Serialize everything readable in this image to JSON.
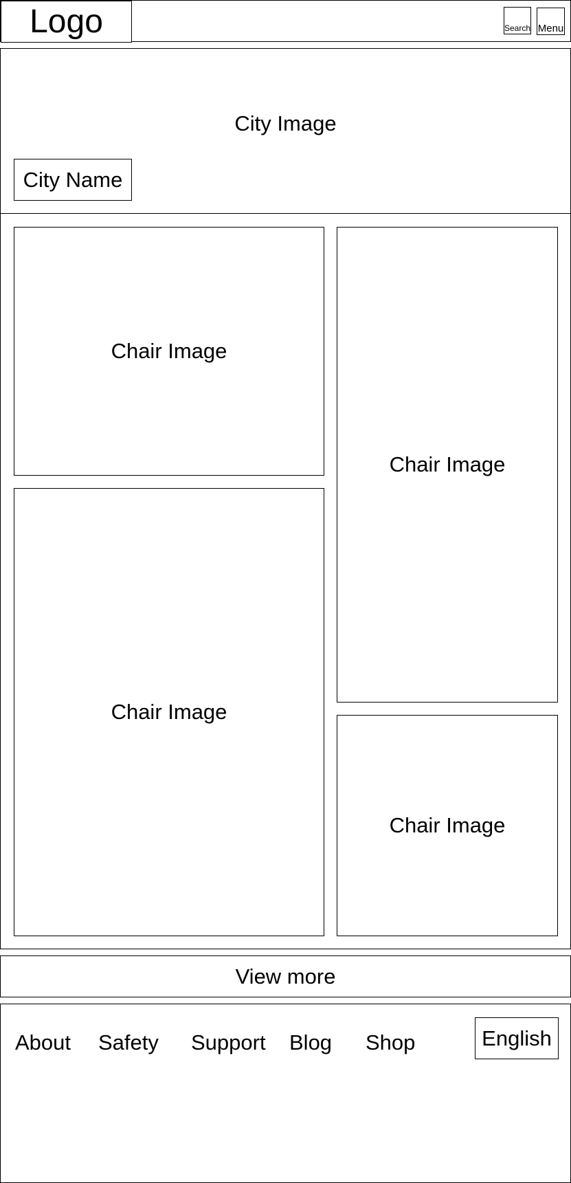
{
  "header": {
    "logo": "Logo",
    "search_label": "Search",
    "menu_label": "Menu"
  },
  "hero": {
    "image_label": "City Image",
    "city_name": "City Name"
  },
  "gallery": {
    "items": [
      {
        "label": "Chair Image"
      },
      {
        "label": "Chair Image"
      },
      {
        "label": "Chair Image"
      },
      {
        "label": "Chair Image"
      }
    ]
  },
  "view_more_label": "View more",
  "footer": {
    "links": [
      {
        "label": "About"
      },
      {
        "label": "Safety"
      },
      {
        "label": "Support"
      },
      {
        "label": "Blog"
      },
      {
        "label": "Shop"
      }
    ],
    "language": "English"
  }
}
